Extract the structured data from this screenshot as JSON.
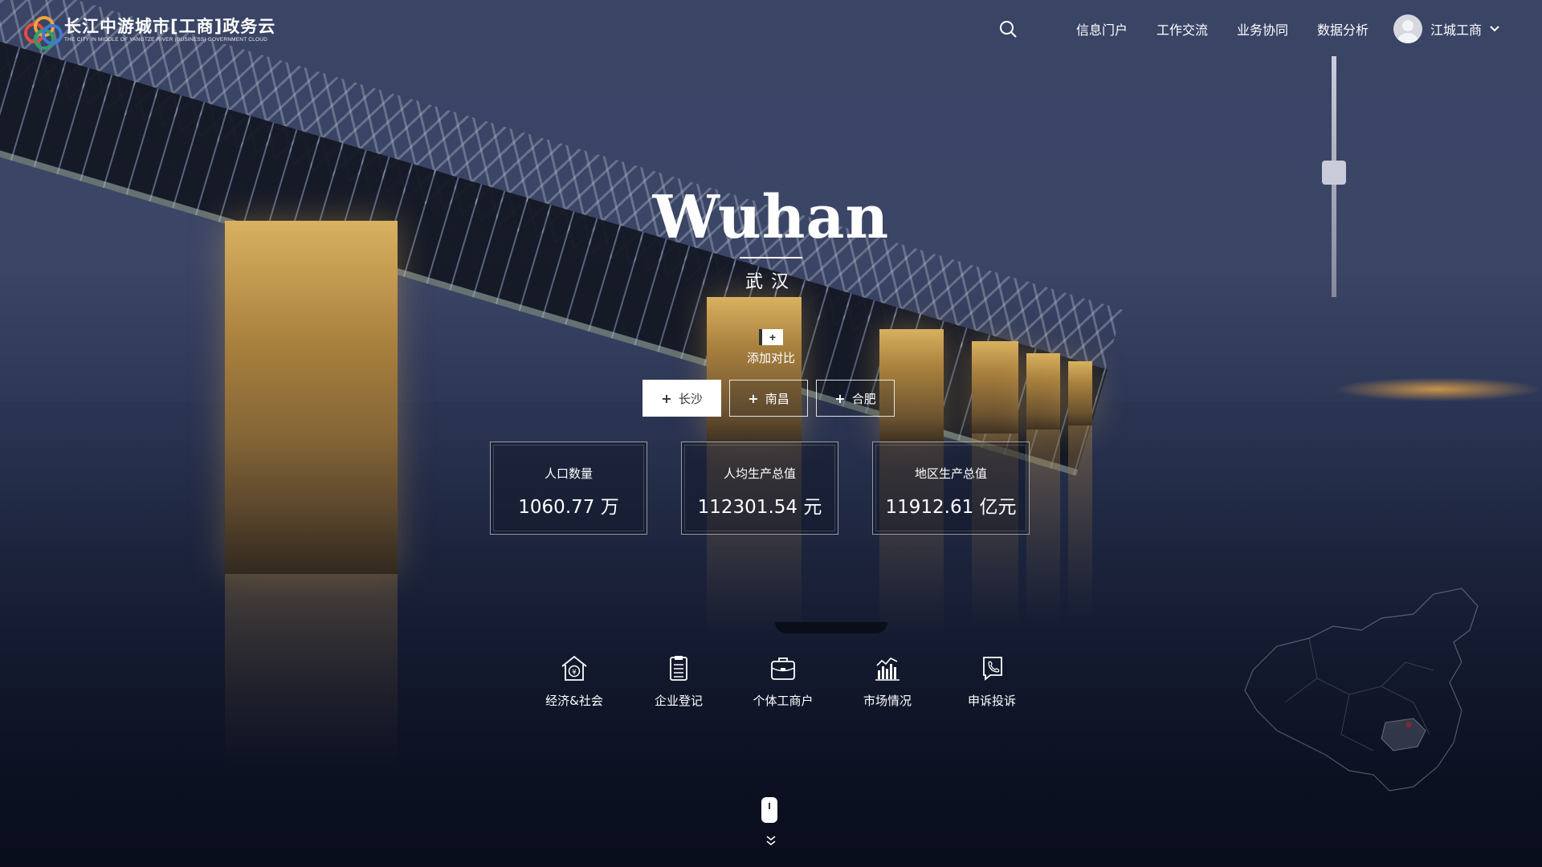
{
  "header": {
    "logo_cn": "长江中游城市[工商]政务云",
    "logo_en": "THE CITY IN MIDDLE OF YANGTZE RIVER (BUSINESS) GOVERNMENT CLOUD",
    "nav": [
      "信息门户",
      "工作交流",
      "业务协同",
      "数据分析"
    ],
    "user_name": "江城工商"
  },
  "hero": {
    "city_en": "Wuhan",
    "city_cn": "武汉",
    "add_compare_label": "添加对比",
    "compare_cities": [
      {
        "label": "长沙",
        "active": true
      },
      {
        "label": "南昌",
        "active": false
      },
      {
        "label": "合肥",
        "active": false
      }
    ]
  },
  "stats": [
    {
      "label": "人口数量",
      "value": "1060.77 万"
    },
    {
      "label": "人均生产总值",
      "value": "112301.54 元"
    },
    {
      "label": "地区生产总值",
      "value": "11912.61 亿元"
    }
  ],
  "categories": [
    {
      "label": "经济&社会",
      "icon": "house-yuan-icon"
    },
    {
      "label": "企业登记",
      "icon": "clipboard-icon"
    },
    {
      "label": "个体工商户",
      "icon": "briefcase-icon"
    },
    {
      "label": "市场情况",
      "icon": "bar-chart-icon"
    },
    {
      "label": "申诉投诉",
      "icon": "phone-complaint-icon"
    }
  ],
  "colors": {
    "map_marker": "#e8323c",
    "active_chip_bg": "#ffffff"
  }
}
